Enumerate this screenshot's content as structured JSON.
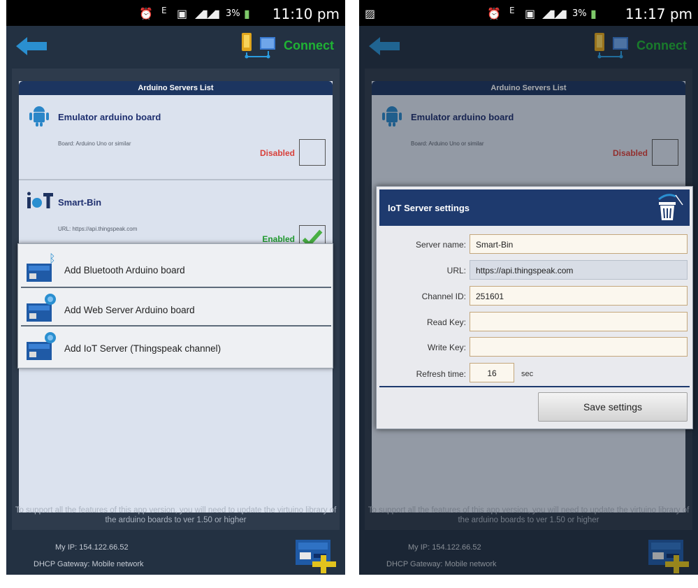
{
  "left": {
    "status_time": "11:10 pm",
    "battery": "3%",
    "connect": "Connect",
    "list_title": "Arduino Servers List",
    "rows": [
      {
        "name": "Emulator arduino board",
        "detail": "Board:  Arduino Uno or similar",
        "status": "Disabled"
      },
      {
        "name": "Smart-Bin",
        "detail": "URL:  https://api.thingspeak.com",
        "status": "Enabled"
      }
    ],
    "menu": [
      {
        "label": "Add Bluetooth Arduino board"
      },
      {
        "label": "Add Web Server Arduino board"
      },
      {
        "label": "Add IoT Server (Thingspeak channel)"
      }
    ],
    "footnote": "To support all the features of this app version, you will need to update the virtuino library of the arduino boards to ver 1.50 or higher",
    "ip": "My IP: 154.122.66.52",
    "gateway": "DHCP Gateway: Mobile network"
  },
  "right": {
    "status_time": "11:17 pm",
    "battery": "3%",
    "connect": "Connect",
    "list_title": "Arduino Servers List",
    "rows": [
      {
        "name": "Emulator arduino board",
        "detail": "Board:  Arduino Uno or similar",
        "status": "Disabled"
      }
    ],
    "dialog": {
      "title": "IoT Server settings",
      "fields": [
        {
          "label": "Server name:",
          "value": "Smart-Bin"
        },
        {
          "label": "URL:",
          "value": "https://api.thingspeak.com"
        },
        {
          "label": "Channel ID:",
          "value": "251601"
        },
        {
          "label": "Read Key:",
          "value": ""
        },
        {
          "label": "Write Key:",
          "value": ""
        },
        {
          "label": "Refresh time:",
          "value": "16"
        }
      ],
      "refresh_unit": "sec",
      "save": "Save settings"
    },
    "footnote": "To support all the features of this app version, you will need to update the virtuino library of the arduino boards to ver 1.50 or higher",
    "ip": "My IP: 154.122.66.52",
    "gateway": "DHCP Gateway: Mobile network"
  },
  "colors": {
    "connect": "#1fb334",
    "disabled": "#d8403a",
    "enabled": "#1f9a2e",
    "header": "#1c3560"
  },
  "icons": [
    "alarm-icon",
    "data-icon",
    "sim-icon",
    "signal-icon",
    "battery-icon",
    "back-arrow-icon",
    "connect-device-icon",
    "android-icon",
    "iot-icon",
    "check-icon",
    "bluetooth-board-icon",
    "web-board-icon",
    "iot-board-icon",
    "add-board-icon",
    "trash-icon",
    "image-icon"
  ]
}
